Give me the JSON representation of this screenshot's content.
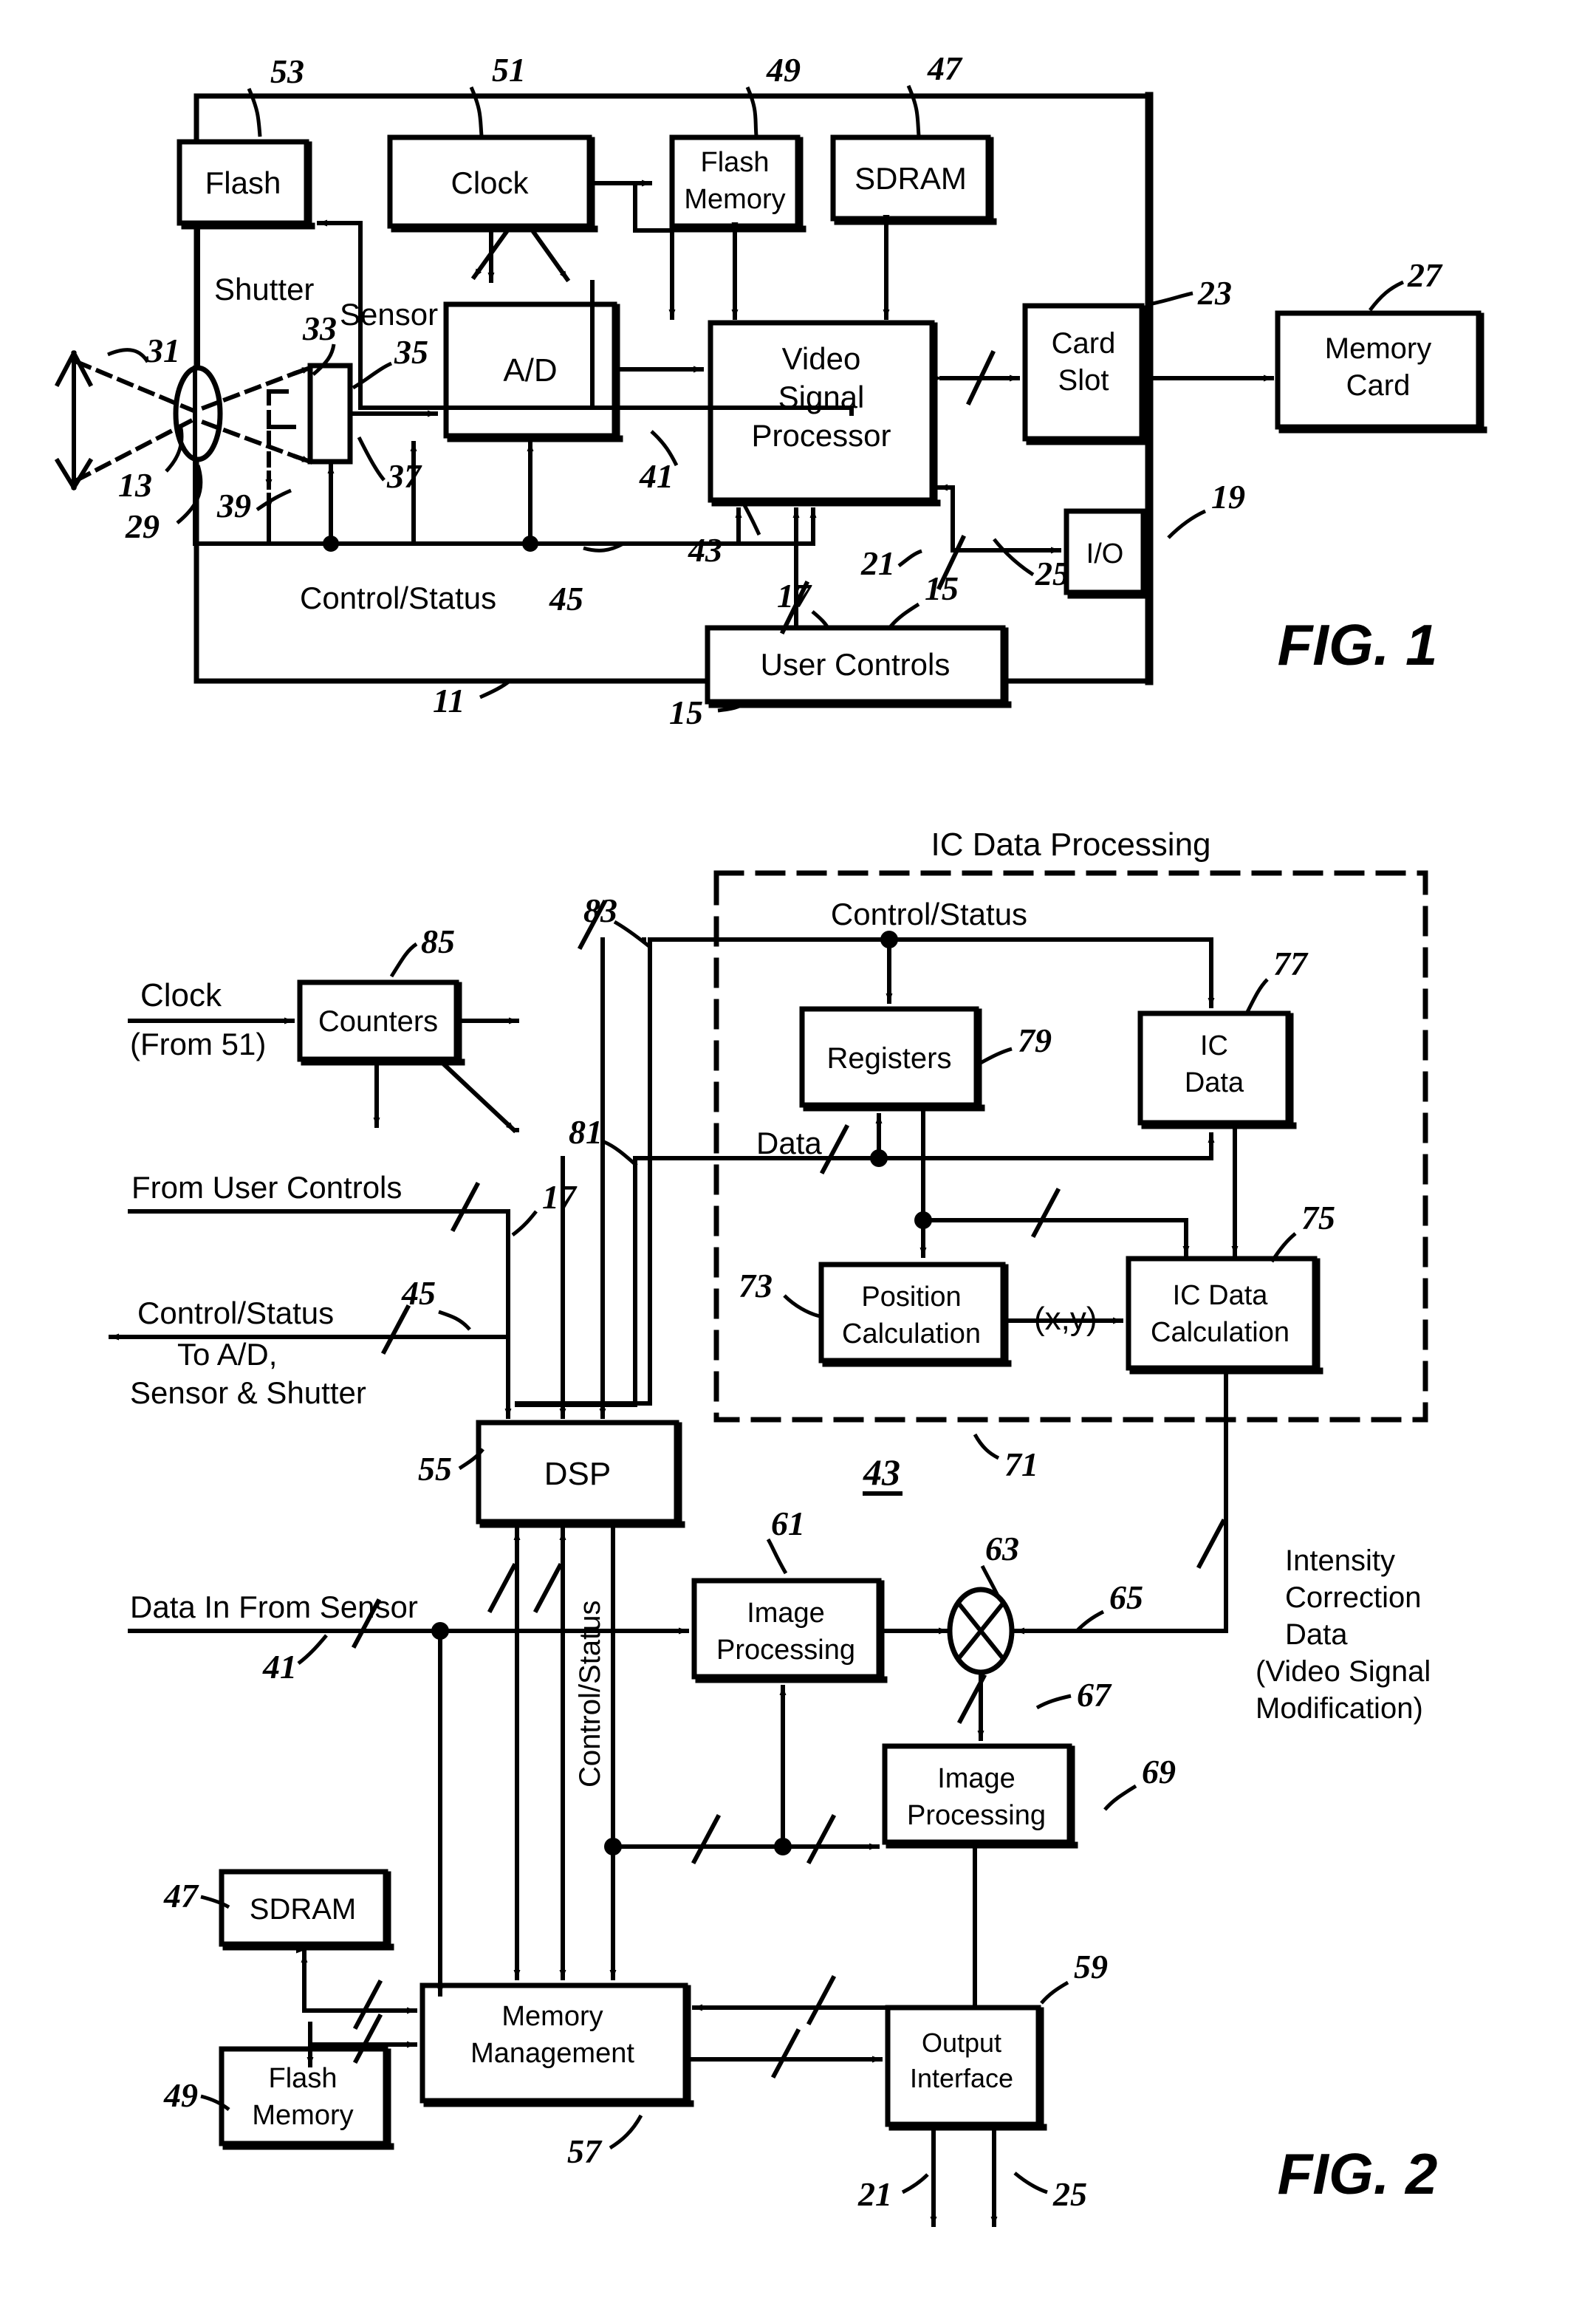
{
  "document": {
    "kind": "patent-drawing-sheet",
    "figures": [
      "FIG. 1",
      "FIG. 2"
    ]
  },
  "fig1": {
    "label": "FIG. 1",
    "blocks": {
      "flash": "Flash",
      "clock": "Clock",
      "flash_memory": "Flash\nMemory",
      "flash_memory_l1": "Flash",
      "flash_memory_l2": "Memory",
      "sdram": "SDRAM",
      "ad": "A/D",
      "vsp_l1": "Video",
      "vsp_l2": "Signal",
      "vsp_l3": "Processor",
      "card_slot_l1": "Card",
      "card_slot_l2": "Slot",
      "memory_card_l1": "Memory",
      "memory_card_l2": "Card",
      "io": "I/O",
      "user_controls": "User Controls"
    },
    "labels": {
      "shutter": "Shutter",
      "sensor": "Sensor",
      "control_status": "Control/Status"
    },
    "refs": {
      "r53": "53",
      "r51": "51",
      "r49": "49",
      "r47": "47",
      "r23": "23",
      "r27": "27",
      "r31": "31",
      "r33": "33",
      "r35": "35",
      "r13": "13",
      "r29": "29",
      "r37": "37",
      "r39": "39",
      "r41": "41",
      "r43": "43",
      "r45": "45",
      "r25": "25",
      "r19": "19",
      "r21": "21",
      "r17": "17",
      "r15a": "15",
      "r15b": "15",
      "r11": "11"
    }
  },
  "fig2": {
    "label": "FIG. 2",
    "blocks": {
      "counters": "Counters",
      "registers": "Registers",
      "ic_data_l1": "IC",
      "ic_data_l2": "Data",
      "position_calc_l1": "Position",
      "position_calc_l2": "Calculation",
      "ic_data_calc_l1": "IC Data",
      "ic_data_calc_l2": "Calculation",
      "dsp": "DSP",
      "image_processing_61_l1": "Image",
      "image_processing_61_l2": "Processing",
      "image_processing_69_l1": "Image",
      "image_processing_69_l2": "Processing",
      "memory_management_l1": "Memory",
      "memory_management_l2": "Management",
      "output_interface_l1": "Output",
      "output_interface_l2": "Interface",
      "sdram": "SDRAM",
      "flash_memory_l1": "Flash",
      "flash_memory_l2": "Memory"
    },
    "labels": {
      "ic_data_processing": "IC Data Processing",
      "control_status_top": "Control/Status",
      "data": "Data",
      "clock": "Clock",
      "clock_from": "(From 51)",
      "from_user_controls": "From User Controls",
      "control_status_left": "Control/Status",
      "to_ad_l1": "To A/D,",
      "to_ad_l2": "Sensor & Shutter",
      "data_in_from_sensor": "Data In From Sensor",
      "control_status_vertical": "Control/Status",
      "xy": "(x,y)",
      "icd_l1": "Intensity",
      "icd_l2": "Correction",
      "icd_l3": "Data",
      "icd_l4": "(Video Signal",
      "icd_l5": "Modification)"
    },
    "refs": {
      "r85": "85",
      "r83": "83",
      "r81": "81",
      "r77": "77",
      "r79": "79",
      "r75": "75",
      "r73": "73",
      "r71": "71",
      "r43": "43",
      "r17": "17",
      "r45": "45",
      "r55": "55",
      "r41": "41",
      "r61": "61",
      "r63": "63",
      "r65": "65",
      "r67": "67",
      "r69": "69",
      "r47": "47",
      "r49": "49",
      "r57": "57",
      "r59": "59",
      "r21": "21",
      "r25": "25"
    }
  },
  "style": {
    "ink": "#000000",
    "paper": "#ffffff"
  }
}
